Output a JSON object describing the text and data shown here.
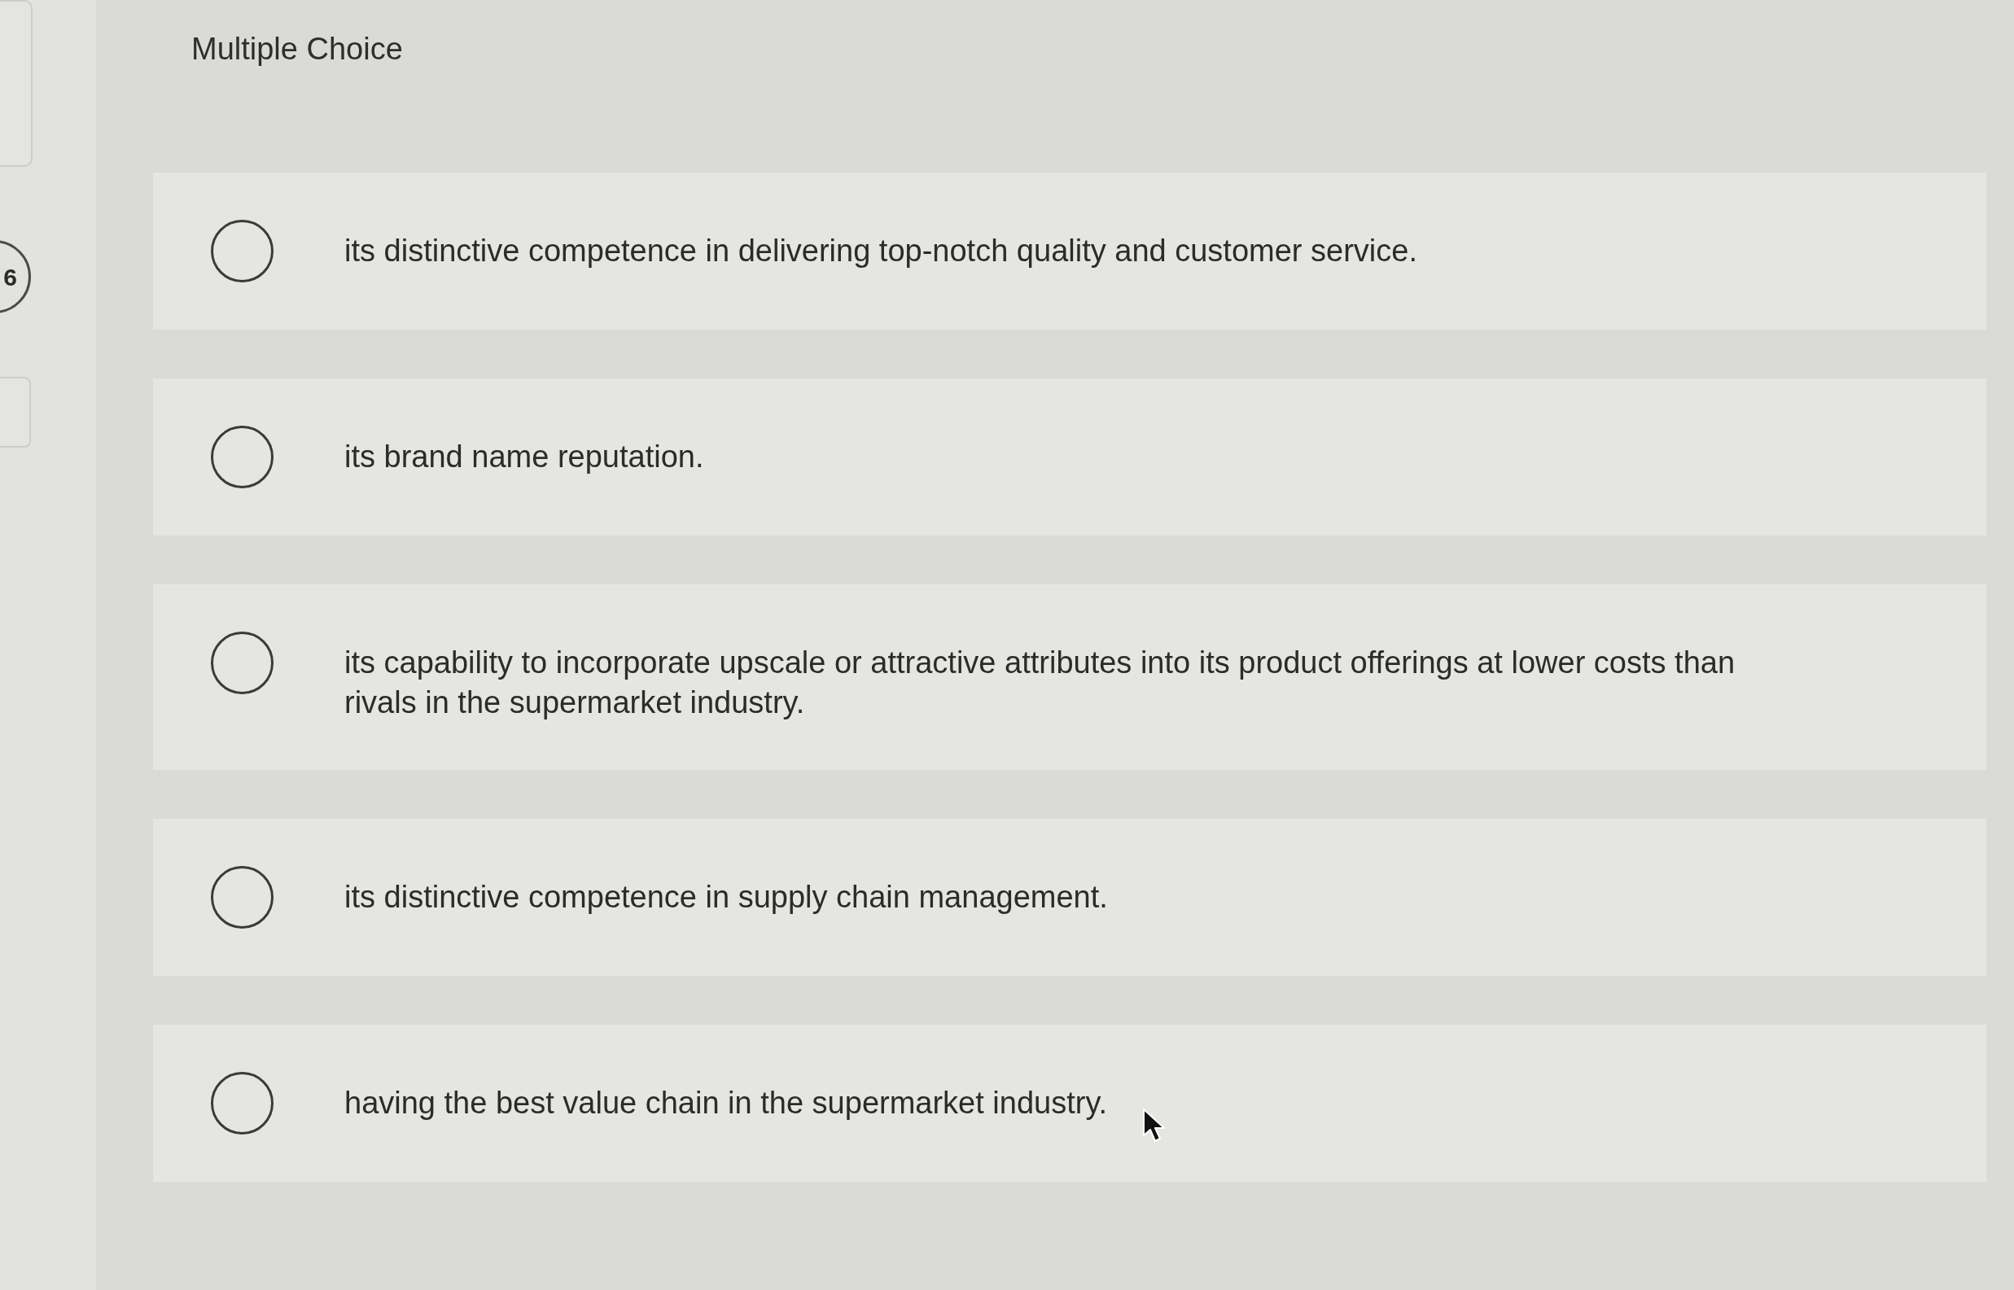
{
  "sidebar": {
    "question_number": "6"
  },
  "question": {
    "heading": "Multiple Choice",
    "options": [
      {
        "text": "its distinctive competence in delivering top-notch quality and customer service.",
        "selected": false
      },
      {
        "text": "its brand name reputation.",
        "selected": false
      },
      {
        "text": "its capability to incorporate upscale or attractive attributes into its product offerings at lower costs than rivals in the supermarket industry.",
        "selected": false
      },
      {
        "text": "its distinctive competence in supply chain management.",
        "selected": false
      },
      {
        "text": "having the best value chain in the supermarket industry.",
        "selected": false
      }
    ]
  }
}
